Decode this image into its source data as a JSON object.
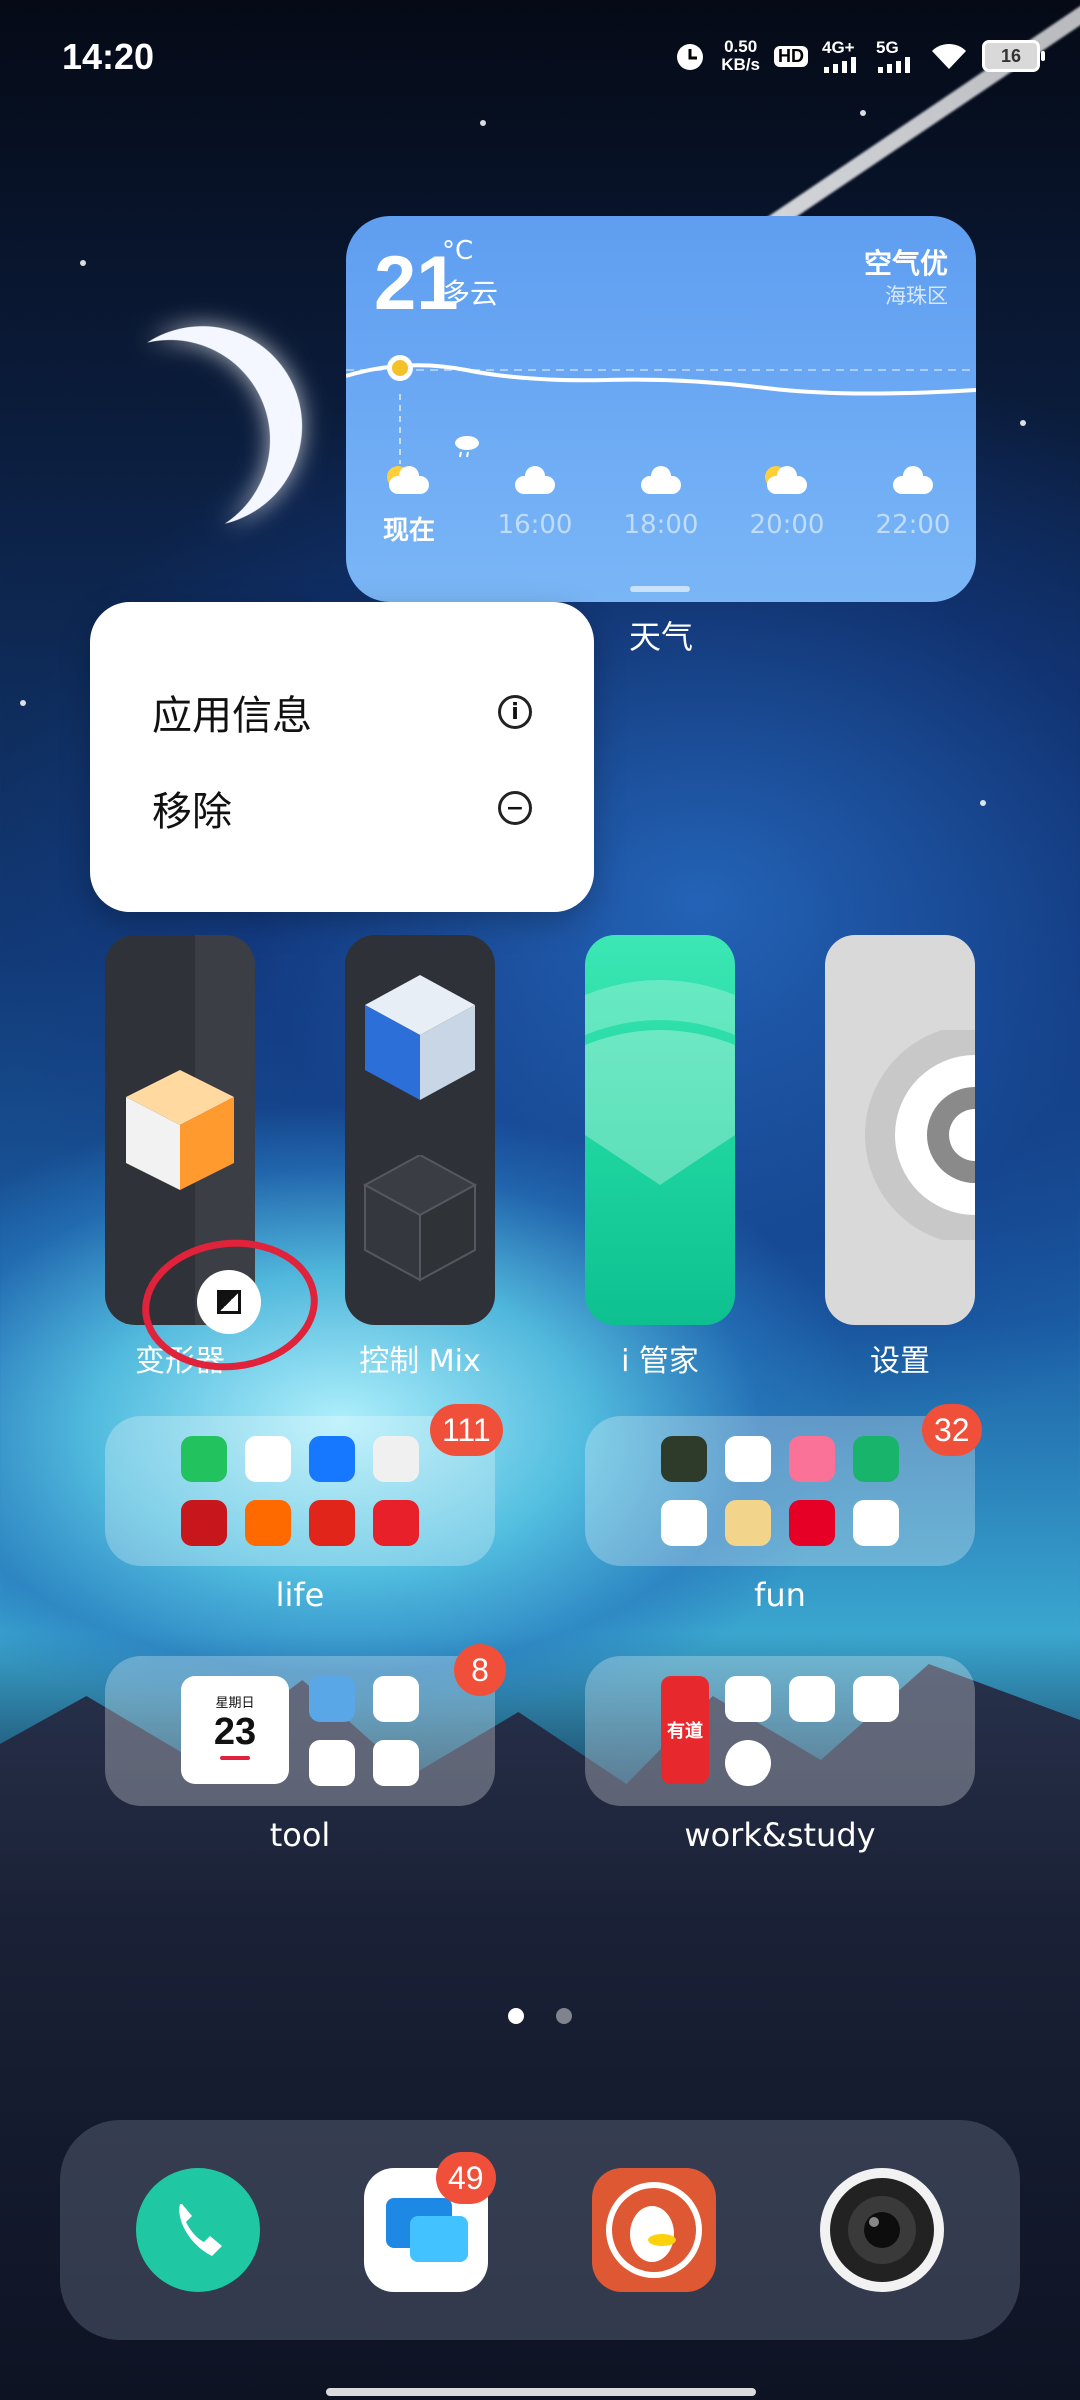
{
  "status_bar": {
    "time": "14:20",
    "net_speed_value": "0.50",
    "net_speed_unit": "KB/s",
    "hd": "HD",
    "signal_1": "4G+",
    "signal_2": "5G",
    "battery": "16",
    "icons": [
      "alarm-icon",
      "hd-voice-icon",
      "cell-signal-icon",
      "cell-signal-icon",
      "wifi-icon",
      "battery-icon"
    ]
  },
  "weather": {
    "temperature": "21",
    "unit": "°C",
    "condition": "多云",
    "air_quality": "空气优",
    "district": "海珠区",
    "hours": [
      {
        "label": "现在",
        "icon": "partly-cloudy-icon"
      },
      {
        "label": "16:00",
        "icon": "cloudy-icon"
      },
      {
        "label": "18:00",
        "icon": "cloudy-icon"
      },
      {
        "label": "20:00",
        "icon": "partly-cloudy-icon"
      },
      {
        "label": "22:00",
        "icon": "cloudy-icon"
      }
    ],
    "widget_label": "天气"
  },
  "context_menu": {
    "items": [
      {
        "label": "应用信息",
        "icon": "info-icon"
      },
      {
        "label": "移除",
        "icon": "remove-icon"
      }
    ]
  },
  "app_cards": [
    {
      "label": "变形器",
      "icon": "transformer-cube-icon"
    },
    {
      "label": "控制 Mix",
      "icon": "control-mix-icon"
    },
    {
      "label": "i 管家",
      "icon": "i-manager-icon"
    },
    {
      "label": "设置",
      "icon": "settings-gear-icon"
    }
  ],
  "folders": [
    {
      "name": "life",
      "badge": "111",
      "apps": [
        "wechat-icon",
        "qq-icon",
        "alipay-icon",
        "maps-icon",
        "huawei-icon",
        "taobao-icon",
        "jd-icon",
        "music-icon"
      ]
    },
    {
      "name": "fun",
      "badge": "32",
      "apps": [
        "wreath-icon",
        "jianshu-icon",
        "bilibili-icon",
        "link-app-icon",
        "weibo-icon",
        "wechat-read-icon",
        "netease-music-icon",
        "snapseed-icon"
      ]
    },
    {
      "name": "tool",
      "badge": "8",
      "apps": [
        "calendar-icon",
        "gallery-icon",
        "notes-icon",
        "lens-icon",
        "circles-icon"
      ],
      "calendar_weekday": "星期日",
      "calendar_day": "23"
    },
    {
      "name": "work&study",
      "badge": "",
      "apps": [
        "youdao-icon",
        "bird-app-icon",
        "star-app-icon",
        "book-app-icon",
        "compass-app-icon"
      ],
      "youdao_text": "有道"
    }
  ],
  "dock": [
    "phone-icon",
    "messages-icon",
    "duckduckgo-icon",
    "camera-icon"
  ],
  "dock_badges": {
    "messages": "49"
  },
  "colors": {
    "badge": "#f0503a",
    "highlight_circle": "#e0223a",
    "weather_bg": "#6aa8f4",
    "phone": "#1fc8a3"
  }
}
